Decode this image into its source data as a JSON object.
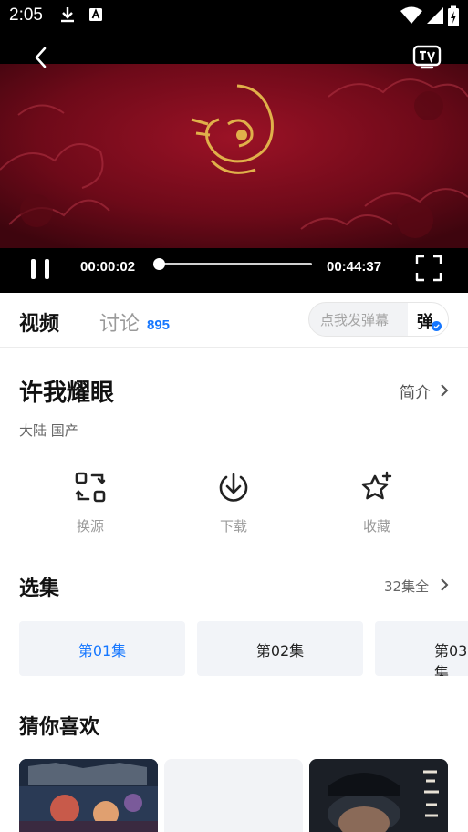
{
  "status_bar": {
    "time": "2:05",
    "icons": [
      "download-icon",
      "a-icon",
      "wifi-icon",
      "signal-icon",
      "battery-charging-icon"
    ]
  },
  "player": {
    "current_time": "00:00:02",
    "total_time": "00:44:37",
    "progress": 0.0007,
    "state": "playing",
    "icons": [
      "back-arrow-icon",
      "tv-cast-icon",
      "pause-icon",
      "fullscreen-icon"
    ]
  },
  "tabs": {
    "video": "视频",
    "discuss": "讨论",
    "discuss_count": "895",
    "danmaku_placeholder": "点我发弹幕",
    "danmaku_toggle": "弹"
  },
  "show": {
    "title": "许我耀眼",
    "intro_label": "简介",
    "tags": "大陆  国产"
  },
  "actions": [
    {
      "label": "换源",
      "icon": "switch-source-icon"
    },
    {
      "label": "下载",
      "icon": "download-circle-icon"
    },
    {
      "label": "收藏",
      "icon": "star-add-icon"
    }
  ],
  "episodes": {
    "title": "选集",
    "count_label": "32集全",
    "items": [
      {
        "label": "第01集",
        "active": true
      },
      {
        "label": "第02集",
        "active": false
      },
      {
        "label": "第03集",
        "active": false
      }
    ]
  },
  "recommend": {
    "title": "猜你喜欢"
  },
  "colors": {
    "accent": "#1677ff",
    "player_red": "#7a0c1c",
    "gold": "#d9a93b"
  }
}
